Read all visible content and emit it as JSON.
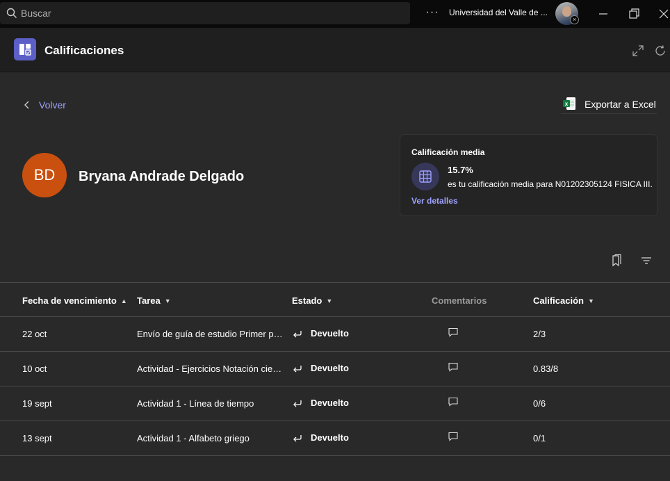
{
  "topbar": {
    "search_placeholder": "Buscar",
    "more_label": "···",
    "organization": "Universidad del Valle de ...",
    "icons": [
      "search-icon",
      "more-icon",
      "avatar",
      "minimize-icon",
      "restore-icon",
      "close-icon"
    ]
  },
  "header": {
    "title": "Calificaciones",
    "icons": [
      "grades-app-icon",
      "expand-icon",
      "refresh-icon"
    ],
    "accent": "#5b5fc7"
  },
  "nav": {
    "back_label": "Volver",
    "export_label": "Exportar a Excel"
  },
  "student": {
    "initials": "BD",
    "name": "Bryana Andrade Delgado",
    "avatar_color": "#ca5010"
  },
  "average_card": {
    "title": "Calificación media",
    "value": "15.7%",
    "description": "es tu calificación media para N01202305124 FISICA III.",
    "link": "Ver detalles",
    "link_color": "#9ea2ff"
  },
  "table": {
    "columns": {
      "due_date": "Fecha de vencimiento",
      "task": "Tarea",
      "status": "Estado",
      "comments": "Comentarios",
      "grade": "Calificación"
    },
    "rows": [
      {
        "date": "22 oct",
        "task": "Envío de guía de estudio Primer parcial",
        "status": "Devuelto",
        "grade": "2/3"
      },
      {
        "date": "10 oct",
        "task": "Actividad - Ejercicios Notación científica",
        "status": "Devuelto",
        "grade": "0.83/8"
      },
      {
        "date": "19 sept",
        "task": "Actividad 1 - Línea de tiempo",
        "status": "Devuelto",
        "grade": "0/6"
      },
      {
        "date": "13 sept",
        "task": "Actividad 1 - Alfabeto griego",
        "status": "Devuelto",
        "grade": "0/1"
      }
    ]
  }
}
